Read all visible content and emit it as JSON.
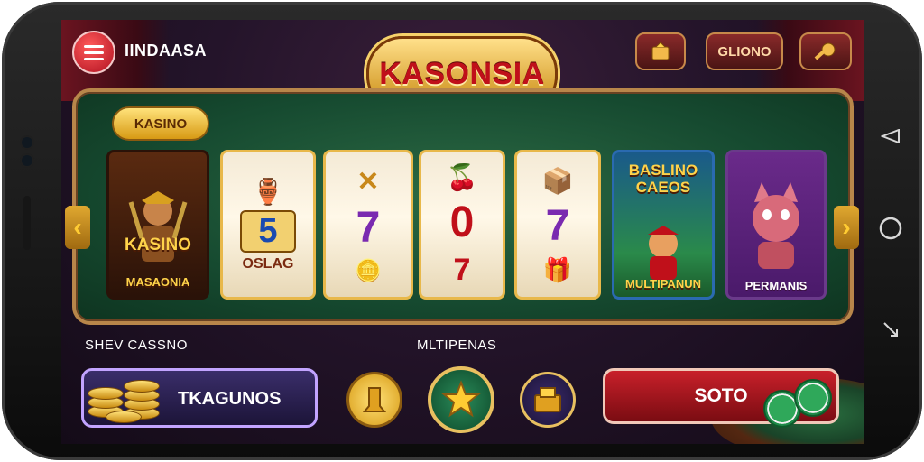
{
  "header": {
    "app_name": "IINDAASA",
    "logo_text": "KASONSIA",
    "right_buttons": [
      {
        "label": ""
      },
      {
        "label": "GLIONO"
      },
      {
        "label": ""
      }
    ]
  },
  "table": {
    "chip_label": "KASINO",
    "cards": [
      {
        "title": "KASINO",
        "subtitle": "MASAONIA"
      },
      {
        "top": "🏺",
        "mid": "5",
        "bottom": "OSLAG"
      },
      {
        "top": "✕",
        "mid": "7",
        "bottom": "🪙"
      },
      {
        "top": "🍒",
        "mid": "0",
        "bottom": "7"
      },
      {
        "top": "📦",
        "mid": "7",
        "bottom": "🎁"
      },
      {
        "title": "BASLINO CAEOS",
        "subtitle": "MULTIPANUN"
      },
      {
        "title": "",
        "subtitle": "PERMANIS"
      }
    ]
  },
  "bottom": {
    "left_label": "SHEV CASSNO",
    "center_label": "MLTIPENAS",
    "coin_button": "TKAGUNOS",
    "action_button": "SOTO"
  },
  "colors": {
    "accent_red": "#b01020",
    "gold": "#e8b84a",
    "felt_green": "#164a30"
  }
}
